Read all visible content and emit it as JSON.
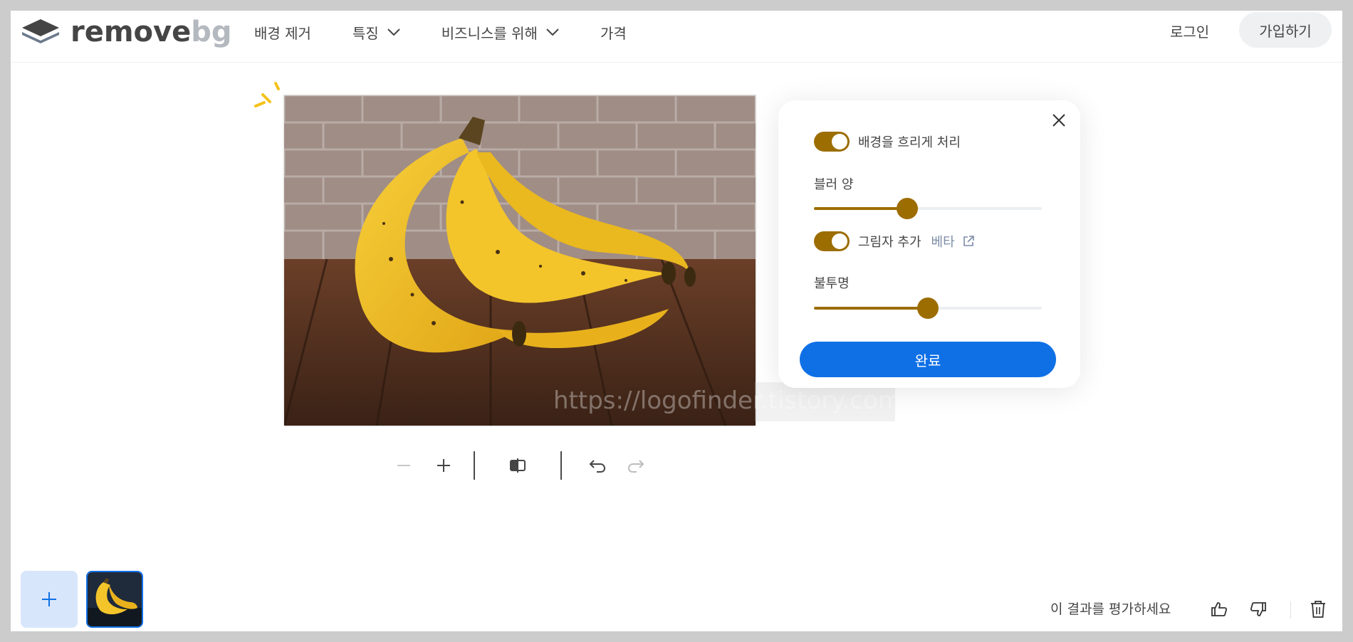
{
  "brand": {
    "name_part1": "remove",
    "name_part2": "bg"
  },
  "nav": {
    "items": [
      {
        "label": "배경 제거",
        "has_dropdown": false
      },
      {
        "label": "특징",
        "has_dropdown": true
      },
      {
        "label": "비즈니스를 위해",
        "has_dropdown": true
      },
      {
        "label": "가격",
        "has_dropdown": false
      }
    ],
    "login": "로그인",
    "signup": "가입하기"
  },
  "editor": {
    "watermark": "https://logofinder.tistory.com",
    "toolbar": [
      "zoom-out-icon",
      "zoom-in-icon",
      "compare-icon",
      "undo-icon",
      "redo-icon"
    ]
  },
  "panel": {
    "blur_toggle_label": "배경을 흐리게 처리",
    "blur_toggle_on": true,
    "blur_amount_label": "블러 양",
    "blur_amount_value": 0.41,
    "shadow_toggle_label": "그림자 추가",
    "shadow_toggle_on": true,
    "beta_label": "베타",
    "opacity_label": "불투명",
    "opacity_value": 0.5,
    "done_label": "완료"
  },
  "footer": {
    "rate_label": "이 결과를 평가하세요"
  },
  "colors": {
    "accent": "#9c6d00",
    "primary": "#0f70e6",
    "text": "#454545"
  }
}
